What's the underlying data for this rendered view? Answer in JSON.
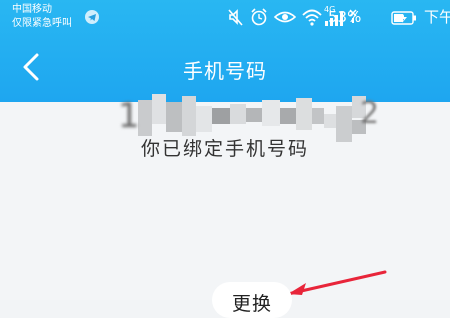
{
  "status_bar": {
    "carrier": "中国移动",
    "emergency": "仅限紧急呼叫",
    "network": "4G",
    "battery": "53%",
    "time_partial": "下午",
    "icons": [
      "telegram-icon",
      "mute-icon",
      "alarm-icon",
      "eye-icon",
      "wifi-icon",
      "signal-icon",
      "battery-icon"
    ]
  },
  "nav": {
    "title": "手机号码",
    "back_icon": "chevron-left-icon"
  },
  "content": {
    "bound_message": "你已绑定手机号码"
  },
  "actions": {
    "change_label": "更换"
  },
  "colors": {
    "header": "#1ea6f0",
    "background": "#f3f5f7",
    "annotation_arrow": "#e8253a"
  }
}
